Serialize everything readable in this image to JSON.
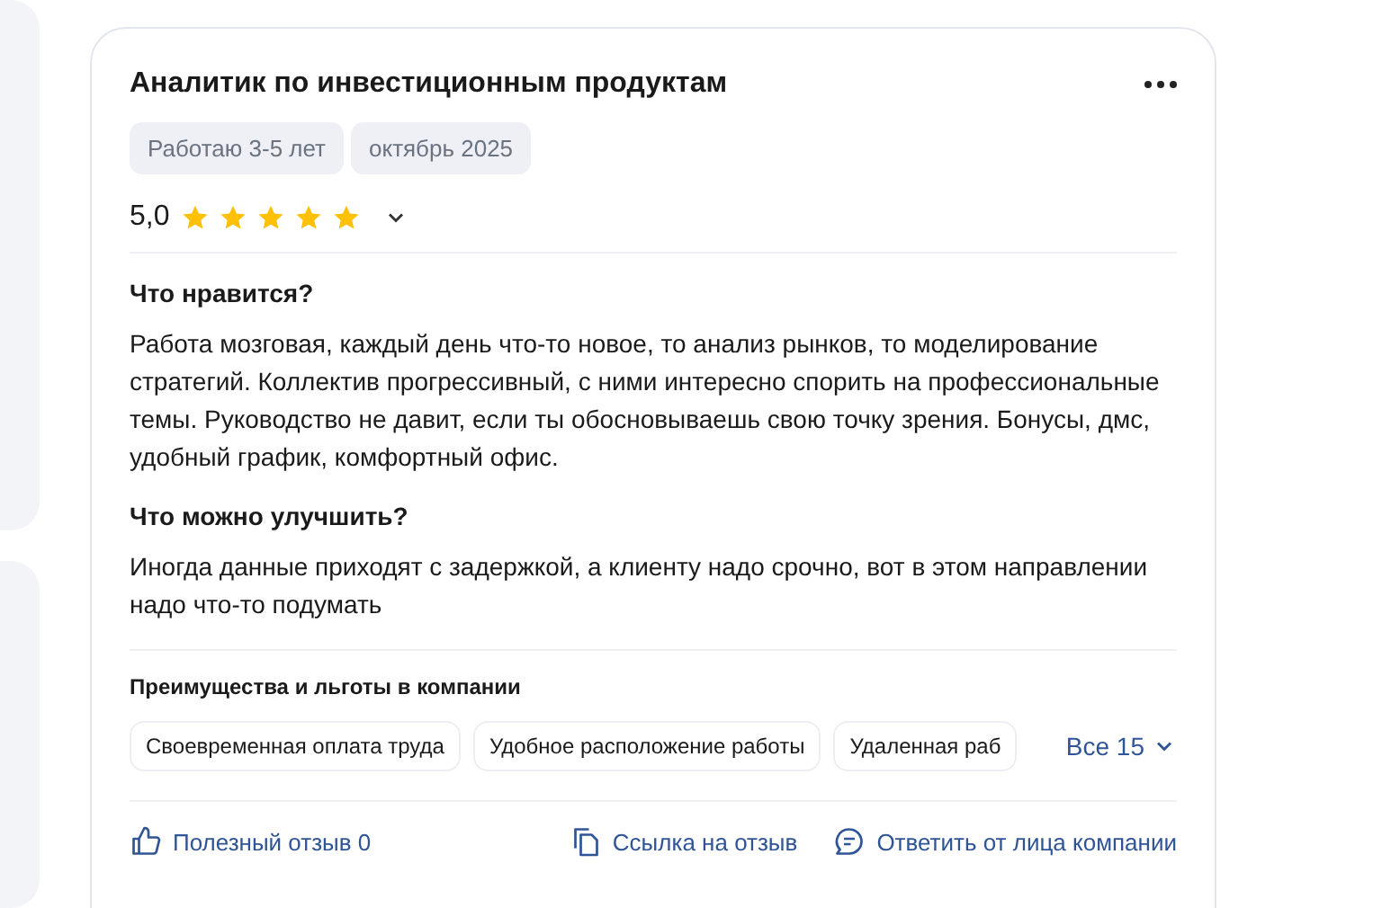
{
  "review": {
    "title": "Аналитик по инвестиционным продуктам",
    "tags": [
      "Работаю 3-5 лет",
      "октябрь 2025"
    ],
    "rating": "5,0",
    "stars": 5,
    "sections": [
      {
        "heading": "Что нравится?",
        "text": "Работа мозговая, каждый день что-то новое, то анализ рынков, то моделирование стратегий. Коллектив прогрессивный, с ними интересно спорить на профессиональные темы. Руководство не давит, если ты обосновываешь свою точку зрения. Бонусы, дмс, удобный график, комфортный офис."
      },
      {
        "heading": "Что можно улучшить?",
        "text": "Иногда данные приходят с задержкой, а клиенту надо срочно, вот в этом направлении надо что-то подумать"
      }
    ],
    "benefits_heading": "Преимущества и льготы в компании",
    "benefits": [
      "Своевременная оплата труда",
      "Удобное расположение работы",
      "Удаленная раб"
    ],
    "benefits_more": "Все 15",
    "actions": [
      {
        "kind": "like",
        "label": "Полезный отзыв 0"
      },
      {
        "kind": "link",
        "label": "Ссылка на отзыв"
      },
      {
        "kind": "reply",
        "label": "Ответить от лица компании"
      }
    ]
  }
}
